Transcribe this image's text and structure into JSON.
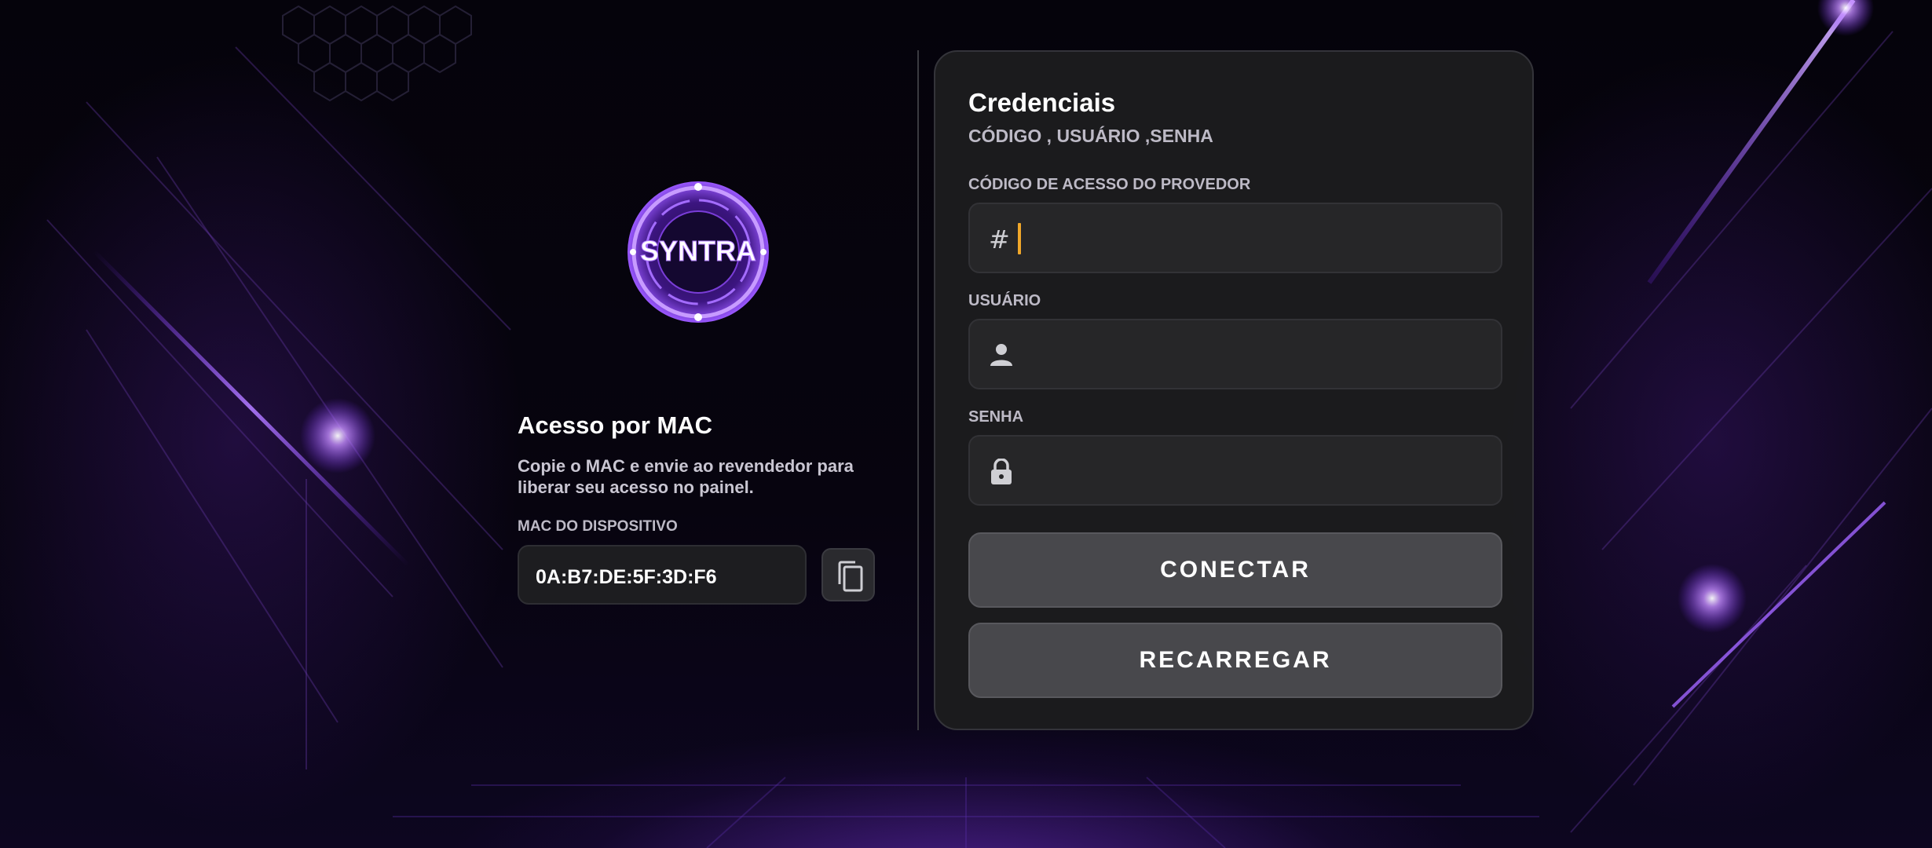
{
  "logo": {
    "text": "SYNTRA"
  },
  "mac_panel": {
    "title": "Acesso por MAC",
    "description": "Copie o MAC e envie ao revendedor para liberar seu acesso no painel.",
    "mac_label": "MAC DO DISPOSITIVO",
    "mac_value": "0A:B7:DE:5F:3D:F6",
    "copy_icon": "copy-icon"
  },
  "credentials": {
    "title": "Credenciais",
    "subtitle": "CÓDIGO , USUÁRIO ,SENHA",
    "fields": [
      {
        "label": "CÓDIGO DE ACESSO DO PROVEDOR",
        "icon": "hash-icon",
        "prefix": "#",
        "value": ""
      },
      {
        "label": "USUÁRIO",
        "icon": "user-icon",
        "value": ""
      },
      {
        "label": "SENHA",
        "icon": "lock-icon",
        "value": ""
      }
    ],
    "connect_label": "CONECTAR",
    "reload_label": "RECARREGAR"
  },
  "colors": {
    "accent_caret": "#f0a72a",
    "brand_purple": "#8a3cff",
    "card_bg": "#1c1c1e",
    "button_bg": "#48484c"
  }
}
